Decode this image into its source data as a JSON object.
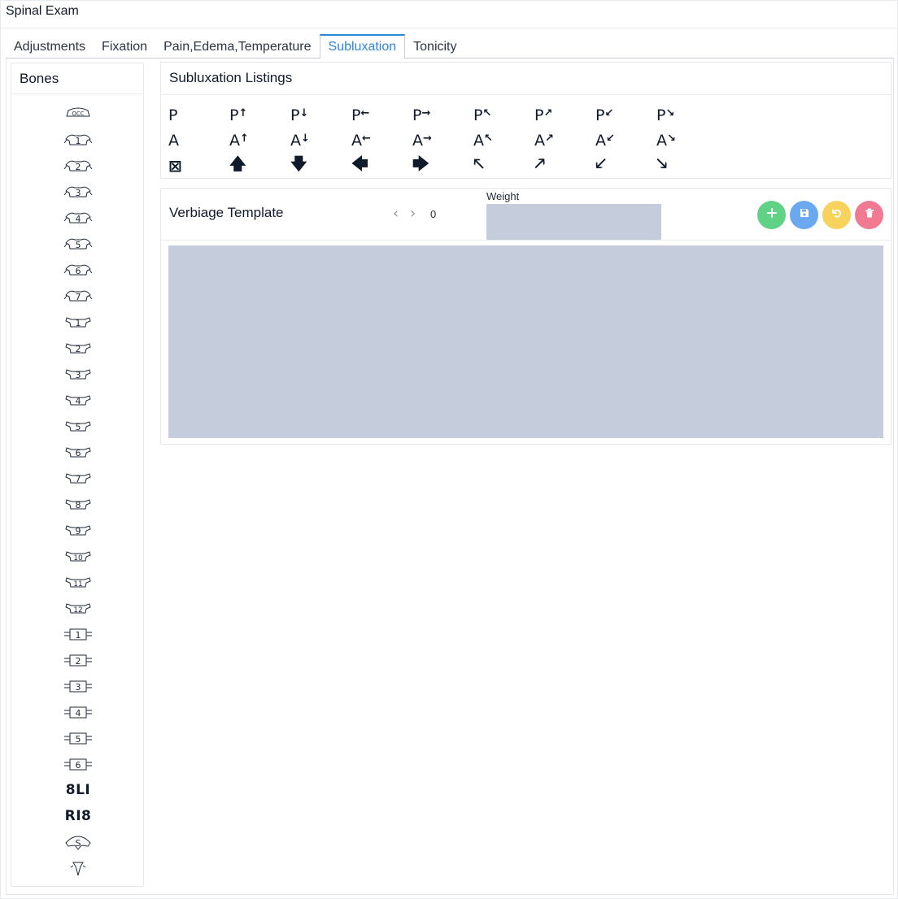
{
  "window": {
    "title": "Spinal Exam"
  },
  "tabs": [
    {
      "label": "Adjustments"
    },
    {
      "label": "Fixation"
    },
    {
      "label": "Pain,Edema,Temperature"
    },
    {
      "label": "Subluxation",
      "active": true
    },
    {
      "label": "Tonicity"
    }
  ],
  "bones": {
    "header": "Bones",
    "items": [
      {
        "kind": "occiput",
        "text": "OCC"
      },
      {
        "kind": "cervical",
        "text": "1"
      },
      {
        "kind": "cervical",
        "text": "2"
      },
      {
        "kind": "cervical",
        "text": "3"
      },
      {
        "kind": "cervical",
        "text": "4"
      },
      {
        "kind": "cervical",
        "text": "5"
      },
      {
        "kind": "cervical",
        "text": "6"
      },
      {
        "kind": "cervical",
        "text": "7"
      },
      {
        "kind": "thoracic",
        "text": "1"
      },
      {
        "kind": "thoracic",
        "text": "2"
      },
      {
        "kind": "thoracic",
        "text": "3"
      },
      {
        "kind": "thoracic",
        "text": "4"
      },
      {
        "kind": "thoracic",
        "text": "5"
      },
      {
        "kind": "thoracic",
        "text": "6"
      },
      {
        "kind": "thoracic",
        "text": "7"
      },
      {
        "kind": "thoracic",
        "text": "8"
      },
      {
        "kind": "thoracic",
        "text": "9"
      },
      {
        "kind": "thoracic",
        "text": "10"
      },
      {
        "kind": "thoracic",
        "text": "11"
      },
      {
        "kind": "thoracic",
        "text": "12"
      },
      {
        "kind": "lumbar",
        "text": "1"
      },
      {
        "kind": "lumbar",
        "text": "2"
      },
      {
        "kind": "lumbar",
        "text": "3"
      },
      {
        "kind": "lumbar",
        "text": "4"
      },
      {
        "kind": "lumbar",
        "text": "5"
      },
      {
        "kind": "lumbar",
        "text": "6"
      },
      {
        "kind": "text",
        "text": "8LI"
      },
      {
        "kind": "text",
        "text": "RI8"
      },
      {
        "kind": "sacrum",
        "text": "S"
      },
      {
        "kind": "coccyx",
        "text": ""
      }
    ]
  },
  "subluxation": {
    "header": "Subluxation Listings",
    "rows": [
      [
        {
          "base": "P",
          "sup": ""
        },
        {
          "base": "P",
          "sup": "↑"
        },
        {
          "base": "P",
          "sup": "↓"
        },
        {
          "base": "P",
          "sup": "←"
        },
        {
          "base": "P",
          "sup": "→"
        },
        {
          "base": "P",
          "sup": "↖"
        },
        {
          "base": "P",
          "sup": "↗"
        },
        {
          "base": "P",
          "sup": "↙"
        },
        {
          "base": "P",
          "sup": "↘"
        }
      ],
      [
        {
          "base": "A",
          "sup": ""
        },
        {
          "base": "A",
          "sup": "↑"
        },
        {
          "base": "A",
          "sup": "↓"
        },
        {
          "base": "A",
          "sup": "←"
        },
        {
          "base": "A",
          "sup": "→"
        },
        {
          "base": "A",
          "sup": "↖"
        },
        {
          "base": "A",
          "sup": "↗"
        },
        {
          "base": "A",
          "sup": "↙"
        },
        {
          "base": "A",
          "sup": "↘"
        }
      ],
      [
        {
          "base": "⊠",
          "sup": ""
        },
        {
          "base": "🡅",
          "sup": ""
        },
        {
          "base": "🡇",
          "sup": ""
        },
        {
          "base": "🡄",
          "sup": ""
        },
        {
          "base": "🡆",
          "sup": ""
        },
        {
          "base": "🡔",
          "sup": ""
        },
        {
          "base": "🡕",
          "sup": ""
        },
        {
          "base": "🡗",
          "sup": ""
        },
        {
          "base": "🡖",
          "sup": ""
        }
      ]
    ]
  },
  "verbiage": {
    "title": "Verbiage Template",
    "prev_icon": "chevron-left-icon",
    "next_icon": "chevron-right-icon",
    "prev_glyph": "‹",
    "next_glyph": "›",
    "count": "0",
    "weight_label": "Weight",
    "weight_value": "",
    "text_value": "",
    "buttons": {
      "add": {
        "icon": "plus-icon",
        "color": "#5fd285"
      },
      "save": {
        "icon": "floppy-disk-icon",
        "color": "#6aa8f0"
      },
      "reset": {
        "icon": "undo-icon",
        "color": "#f7d25c"
      },
      "delete": {
        "icon": "trash-icon",
        "color": "#f07a92"
      }
    }
  },
  "colors": {
    "accent": "#2e86d6",
    "input_bg": "#c5ccdb",
    "ink": "#0f1a2b"
  }
}
